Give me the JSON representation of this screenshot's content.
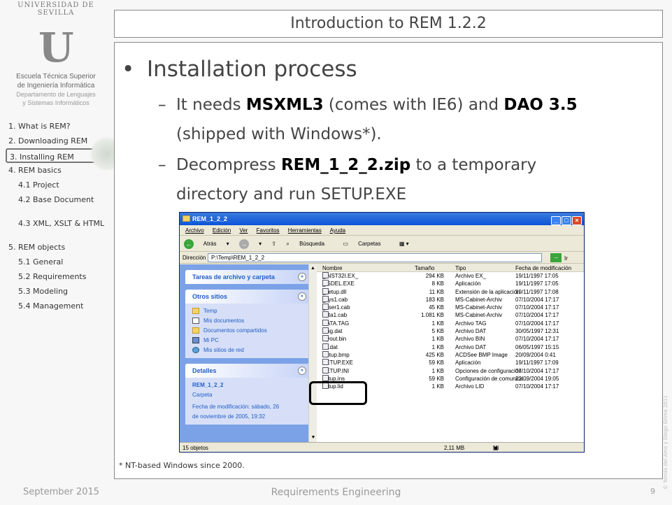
{
  "logo": {
    "arc_text": "UNIVERSIDAD DE SEVILLA",
    "mark": "U",
    "school_1": "Escuela Técnica Superior",
    "school_2": "de Ingeniería Informática",
    "dept_1": "Departamento de Lenguajes",
    "dept_2": "y Sistemas Informáticos"
  },
  "nav": {
    "items": [
      "1.  What is REM?",
      "2.  Downloading REM",
      "3.  Installing REM",
      "4.  REM basics",
      "4.1 Project",
      "4.2 Base Document",
      "4.3 XML, XSLT & HTML",
      "5. REM objects",
      "5.1 General",
      "5.2 Requirements",
      "5.3 Modeling",
      "5.4 Management"
    ]
  },
  "title": "Introduction to REM 1.2.2",
  "bullet": "Installation process",
  "sub1": {
    "a": "It needs ",
    "b": "MSXML3",
    "c": " (comes with IE6) and ",
    "d": "DAO 3.5",
    "e": "(shipped with Windows*)."
  },
  "sub2": {
    "a": "Decompress ",
    "b": "REM_1_2_2.zip",
    "c": " to a temporary",
    "d": "directory and run SETUP.EXE"
  },
  "window": {
    "title": "REM_1_2_2",
    "menu": [
      "Archivo",
      "Edición",
      "Ver",
      "Favoritos",
      "Herramientas",
      "Ayuda"
    ],
    "toolbar": {
      "back": "Atrás",
      "search": "Búsqueda",
      "folders": "Carpetas"
    },
    "address_label": "Dirección",
    "address_value": "P:\\Temp\\REM_1_2_2",
    "go": "Ir",
    "panels": {
      "tasks": "Tareas de archivo y carpeta",
      "other": "Otros sitios",
      "places": [
        "Temp",
        "Mis documentos",
        "Documentos compartidos",
        "Mi PC",
        "Mis sitios de red"
      ],
      "details": "Detalles",
      "detail_name": "REM_1_2_2",
      "detail_type": "Carpeta",
      "detail_mod_1": "Fecha de modificación: sábado, 26",
      "detail_mod_2": "de noviembre de 2005, 19:32"
    },
    "columns": [
      "Nombre",
      "Tamaño",
      "Tipo",
      "Fecha de modificación"
    ],
    "files": [
      [
        "_INST32I.EX_",
        "294 KB",
        "Archivo EX_",
        "19/11/1997 17:05"
      ],
      [
        "_ISDEL.EXE",
        "8 KB",
        "Aplicación",
        "19/11/1997 17:05"
      ],
      [
        "_setup.dll",
        "11 KB",
        "Extensión de la aplicación",
        "19/11/1997 17:08"
      ],
      [
        "_sys1.cab",
        "183 KB",
        "MS-Cabinet-Archiv",
        "07/10/2004 17:17"
      ],
      [
        "_user1.cab",
        "45 KB",
        "MS-Cabinet-Archiv",
        "07/10/2004 17:17"
      ],
      [
        "data1.cab",
        "1.081 KB",
        "MS-Cabinet-Archiv",
        "07/10/2004 17:17"
      ],
      [
        "DATA.TAG",
        "1 KB",
        "Archivo TAG",
        "07/10/2004 17:17"
      ],
      [
        "lang.dat",
        "5 KB",
        "Archivo DAT",
        "30/05/1997 12:31"
      ],
      [
        "layout.bin",
        "1 KB",
        "Archivo BIN",
        "07/10/2004 17:17"
      ],
      [
        "os.dat",
        "1 KB",
        "Archivo DAT",
        "06/05/1997 15:15"
      ],
      [
        "Setup.bmp",
        "425 KB",
        "ACDSee BMP Image",
        "20/09/2004 0:41"
      ],
      [
        "SETUP.EXE",
        "59 KB",
        "Aplicación",
        "19/11/1997 17:09"
      ],
      [
        "SETUP.INI",
        "1 KB",
        "Opciones de configuración",
        "07/10/2004 17:17"
      ],
      [
        "setup.ins",
        "59 KB",
        "Configuración de comunica...",
        "22/09/2004 19:05"
      ],
      [
        "setup.lid",
        "1 KB",
        "Archivo LID",
        "07/10/2004 17:17"
      ]
    ],
    "status_count": "15 objetos",
    "status_size": "2,11 MB",
    "status_loc": "Mi PC"
  },
  "footnote": "* NT-based Windows since 2000.",
  "footer": {
    "date": "September 2015",
    "center": "Requirements Engineering",
    "page": "9"
  },
  "vertical_credit": "© Tomás del Amo y Diego Grima 2011"
}
